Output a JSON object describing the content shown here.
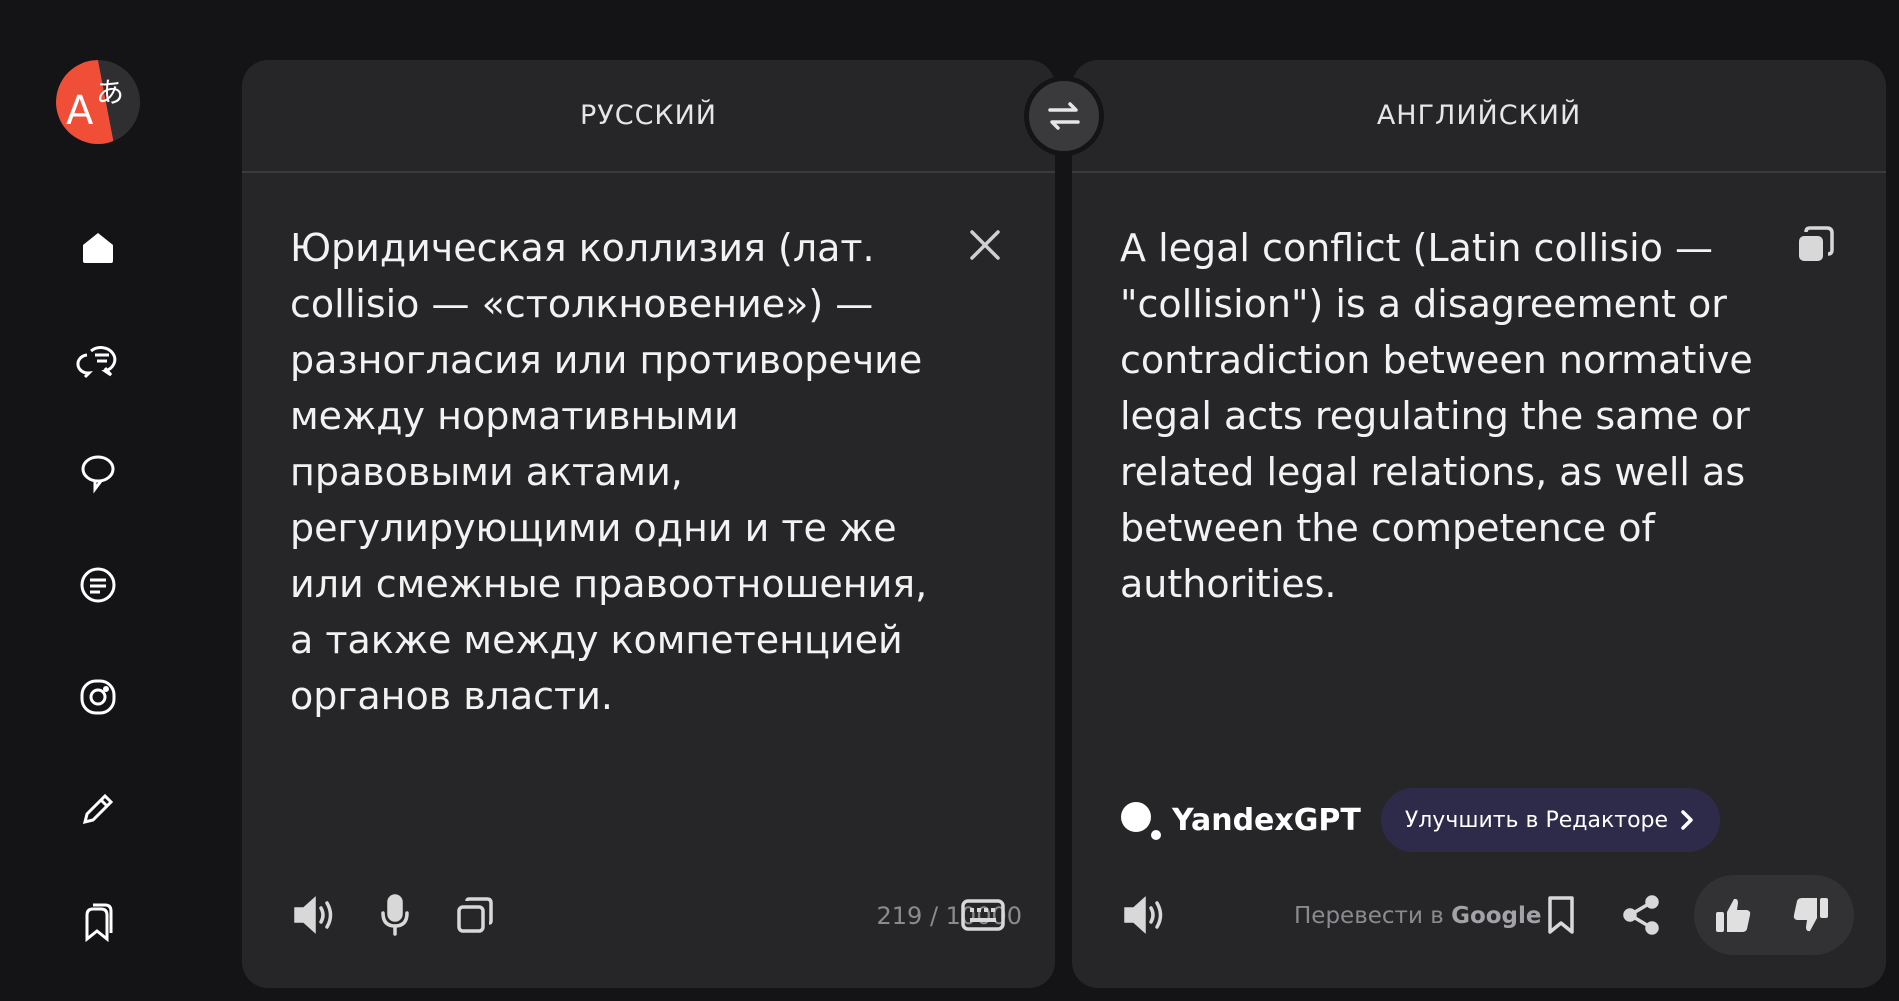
{
  "app": {
    "logo_icon": "translate-logo-icon"
  },
  "sidebar": {
    "items": [
      {
        "name": "home",
        "icon": "home-icon"
      },
      {
        "name": "dialog",
        "icon": "chat-bubbles-icon"
      },
      {
        "name": "chat",
        "icon": "speech-bubble-icon"
      },
      {
        "name": "documents",
        "icon": "document-text-icon"
      },
      {
        "name": "images",
        "icon": "camera-icon"
      },
      {
        "name": "editor",
        "icon": "pencil-icon"
      },
      {
        "name": "collections",
        "icon": "bookmarks-icon"
      }
    ]
  },
  "source": {
    "language": "РУССКИЙ",
    "text": "Юридическая коллизия (лат. collisio — «столкновение») — разногласия или противоречие между нормативными правовыми актами, регулирующими одни и те же или смежные правоотношения, а также между компетенцией органов власти.",
    "counter": "219 / 10000"
  },
  "target": {
    "language": "АНГЛИЙСКИЙ",
    "text": "A legal conflict (Latin collisio — \"collision\") is a disagreement or contradiction between normative legal acts regulating the same or related legal relations, as well as between the competence of authorities.",
    "engine": "YandexGPT",
    "improve_label": "Улучшить в Редакторе",
    "google_prefix": "Перевести в ",
    "google_brand": "Google"
  },
  "colors": {
    "background": "#141416",
    "panel": "#262628",
    "accent_button": "#2e2a4a",
    "logo_red": "#f04e37"
  }
}
